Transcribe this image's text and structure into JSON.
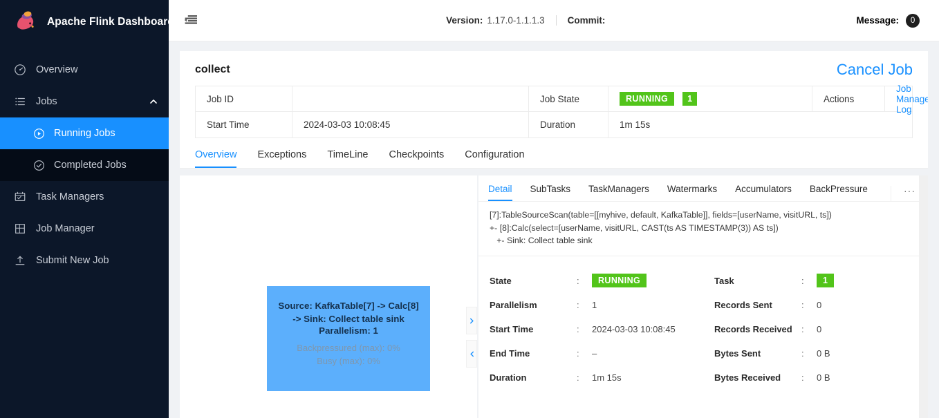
{
  "sidebar": {
    "brand": "Apache Flink Dashboard",
    "logo_icon": "flink-squirrel-logo",
    "items": [
      {
        "label": "Overview",
        "icon": "dashboard-icon"
      },
      {
        "label": "Jobs",
        "icon": "list-icon",
        "expand_icon": "chevron-up-icon"
      },
      {
        "label": "Task Managers",
        "icon": "task-managers-icon"
      },
      {
        "label": "Job Manager",
        "icon": "job-manager-icon"
      },
      {
        "label": "Submit New Job",
        "icon": "upload-icon"
      }
    ],
    "submenu": [
      {
        "label": "Running Jobs",
        "icon": "play-circle-icon",
        "active": true
      },
      {
        "label": "Completed Jobs",
        "icon": "check-circle-icon",
        "active": false
      }
    ]
  },
  "topbar": {
    "fold_icon": "menu-fold-icon",
    "version_label": "Version:",
    "version_value": "1.17.0-1.1.1.3",
    "commit_label": "Commit:",
    "commit_value": "",
    "message_label": "Message:",
    "message_count": "0"
  },
  "job": {
    "name": "collect",
    "cancel_label": "Cancel Job",
    "fields": {
      "job_id_label": "Job ID",
      "job_id_value": "",
      "job_state_label": "Job State",
      "job_state_value": "RUNNING",
      "job_state_count": "1",
      "actions_label": "Actions",
      "actions_link": "Job Manager Log",
      "start_time_label": "Start Time",
      "start_time_value": "2024-03-03 10:08:45",
      "duration_label": "Duration",
      "duration_value": "1m 15s"
    }
  },
  "tabs": [
    {
      "label": "Overview",
      "active": true
    },
    {
      "label": "Exceptions",
      "active": false
    },
    {
      "label": "TimeLine",
      "active": false
    },
    {
      "label": "Checkpoints",
      "active": false
    },
    {
      "label": "Configuration",
      "active": false
    }
  ],
  "graph": {
    "node": {
      "title_line1": "Source: KafkaTable[7] -> Calc[8]",
      "title_line2": "-> Sink: Collect table sink",
      "parallelism": "Parallelism: 1",
      "backpressured": "Backpressured (max): 0%",
      "busy": "Busy (max): 0%",
      "color": "#5caffc"
    },
    "expand_icon": "chevron-right-icon",
    "collapse_icon": "chevron-left-icon"
  },
  "detail": {
    "tabs": [
      {
        "label": "Detail",
        "active": true
      },
      {
        "label": "SubTasks",
        "active": false
      },
      {
        "label": "TaskManagers",
        "active": false
      },
      {
        "label": "Watermarks",
        "active": false
      },
      {
        "label": "Accumulators",
        "active": false
      },
      {
        "label": "BackPressure",
        "active": false
      }
    ],
    "more_icon": "ellipsis-icon",
    "more_label": "···",
    "plan_text": "[7]:TableSourceScan(table=[[myhive, default, KafkaTable]], fields=[userName, visitURL, ts])\n+- [8]:Calc(select=[userName, visitURL, CAST(ts AS TIMESTAMP(3)) AS ts])\n   +- Sink: Collect table sink",
    "left_rows": [
      {
        "key": "State",
        "value": "RUNNING",
        "badge": true
      },
      {
        "key": "Parallelism",
        "value": "1",
        "badge": false
      },
      {
        "key": "Start Time",
        "value": "2024-03-03 10:08:45",
        "badge": false
      },
      {
        "key": "End Time",
        "value": "–",
        "badge": false
      },
      {
        "key": "Duration",
        "value": "1m 15s",
        "badge": false
      }
    ],
    "right_rows": [
      {
        "key": "Task",
        "value": "1",
        "badge": true
      },
      {
        "key": "Records Sent",
        "value": "0",
        "badge": false
      },
      {
        "key": "Records Received",
        "value": "0",
        "badge": false
      },
      {
        "key": "Bytes Sent",
        "value": "0 B",
        "badge": false
      },
      {
        "key": "Bytes Received",
        "value": "0 B",
        "badge": false
      }
    ],
    "colon": ":"
  },
  "colors": {
    "accent_blue": "#1890ff",
    "status_green": "#52c41a",
    "sidebar_bg": "#0c1729",
    "submenu_bg": "#050c17",
    "node_blue": "#5caffc"
  }
}
